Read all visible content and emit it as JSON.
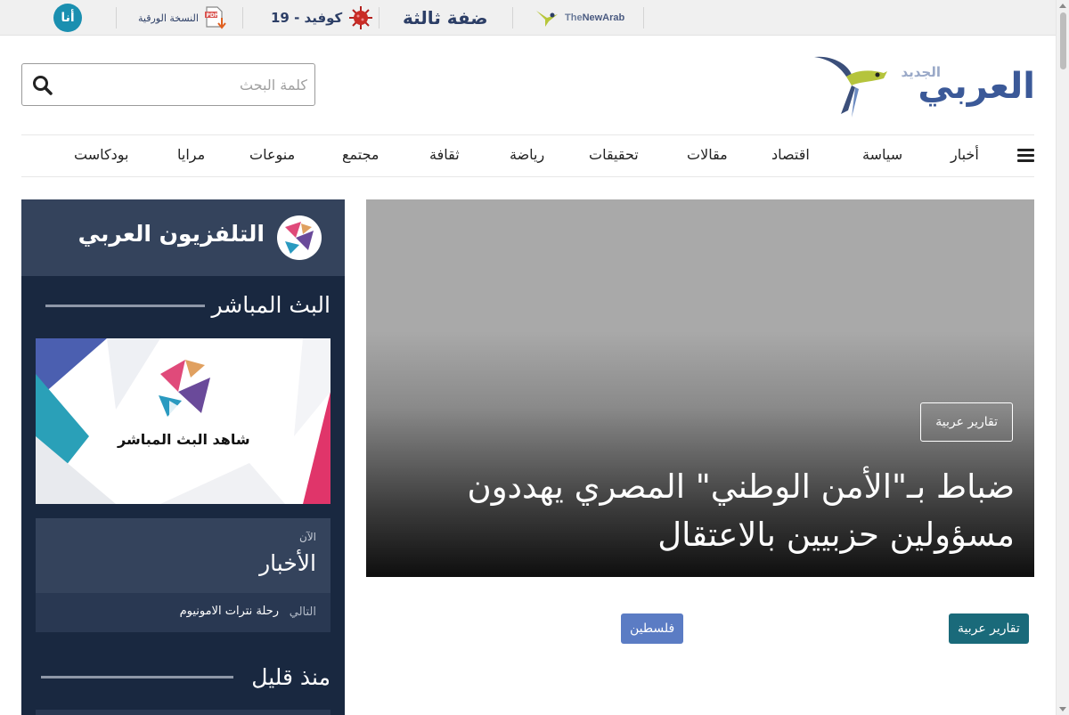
{
  "topbar": {
    "newarab": {
      "prefix": "The",
      "name": "NewArab"
    },
    "daffa": "ضفة ثالثة",
    "covid": "كوفيد - 19",
    "pdf": "النسخة الورقية",
    "ana": "أنا"
  },
  "header": {
    "logo_main": "العربي",
    "logo_sub": "الجديد",
    "search_placeholder": "كلمة البحث"
  },
  "nav": {
    "items": [
      "أخبار",
      "سياسة",
      "اقتصاد",
      "مقالات",
      "تحقيقات",
      "رياضة",
      "ثقافة",
      "مجتمع",
      "منوعات",
      "مرايا",
      "بودكاست"
    ]
  },
  "hero": {
    "category": "تقارير عربية",
    "title": "ضباط بـ\"الأمن الوطني\" المصري يهددون مسؤولين حزبيين بالاعتقال"
  },
  "tags": {
    "teal": "تقارير عربية",
    "blue": "فلسطين"
  },
  "sidebar": {
    "title": "التلفزيون العربي",
    "live_section": "البث المباشر",
    "video_caption": "شاهد البث المباشر",
    "now_label": "الآن",
    "now_title": "الأخبار",
    "next_label": "التالي",
    "next_title": "رحلة نترات الامونيوم",
    "recent_section": "منذ قليل"
  },
  "colors": {
    "brand_blue": "#3b5998",
    "sidebar_bg": "#192840",
    "sidebar_head": "#34435c",
    "tag_teal": "#1a6a7a",
    "tag_blue": "#5b7cc4"
  }
}
